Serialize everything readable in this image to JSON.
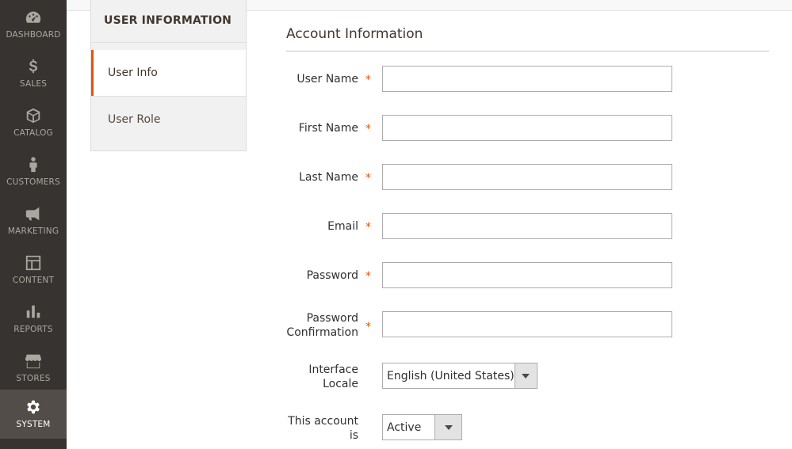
{
  "nav": {
    "items": [
      {
        "label": "DASHBOARD",
        "icon": "dashboard-icon"
      },
      {
        "label": "SALES",
        "icon": "dollar-icon"
      },
      {
        "label": "CATALOG",
        "icon": "cube-icon"
      },
      {
        "label": "CUSTOMERS",
        "icon": "person-icon"
      },
      {
        "label": "MARKETING",
        "icon": "megaphone-icon"
      },
      {
        "label": "CONTENT",
        "icon": "layout-icon"
      },
      {
        "label": "REPORTS",
        "icon": "bar-chart-icon"
      },
      {
        "label": "STORES",
        "icon": "storefront-icon"
      },
      {
        "label": "SYSTEM",
        "icon": "gear-icon"
      }
    ],
    "active": "SYSTEM"
  },
  "tabs": {
    "title": "USER INFORMATION",
    "items": [
      {
        "label": "User Info",
        "active": true
      },
      {
        "label": "User Role",
        "active": false
      }
    ]
  },
  "form": {
    "section_title": "Account Information",
    "fields": {
      "username": {
        "label": "User Name",
        "value": ""
      },
      "firstname": {
        "label": "First Name",
        "value": ""
      },
      "lastname": {
        "label": "Last Name",
        "value": ""
      },
      "email": {
        "label": "Email",
        "value": ""
      },
      "password": {
        "label": "Password",
        "value": ""
      },
      "password_confirmation": {
        "label_line1": "Password",
        "label_line2": "Confirmation",
        "value": ""
      },
      "interface_locale": {
        "label_line1": "Interface",
        "label_line2": "Locale",
        "value": "English (United States)"
      },
      "account_status": {
        "label_line1": "This account",
        "label_line2": "is",
        "value": "Active"
      }
    },
    "required_mark": "*"
  },
  "colors": {
    "nav_bg": "#373330",
    "nav_active_bg": "#524d49",
    "accent": "#eb5202"
  }
}
